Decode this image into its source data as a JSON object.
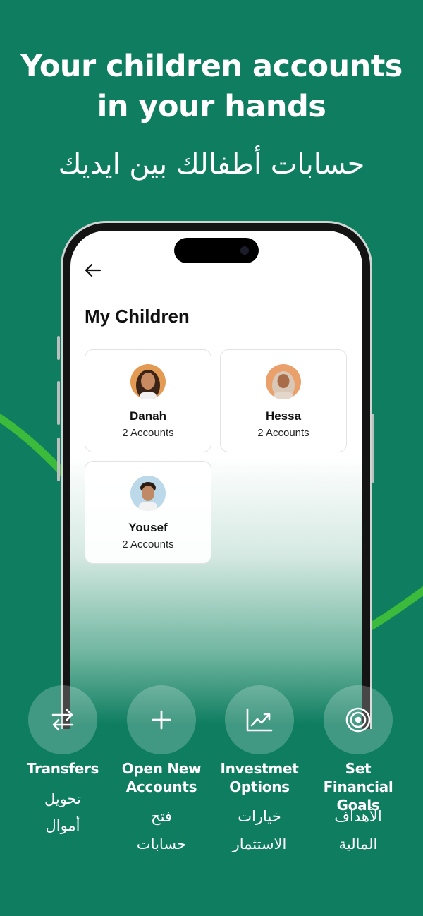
{
  "headline": {
    "line1": "Your children accounts",
    "line2": "in your hands",
    "arabic": "حسابات أطفالك بين ايديك"
  },
  "screen": {
    "back_icon": "arrow-left-icon",
    "title": "My Children",
    "children": [
      {
        "name": "Danah",
        "accounts": "2 Accounts",
        "avatar": "girl-avatar"
      },
      {
        "name": "Hessa",
        "accounts": "2 Accounts",
        "avatar": "girl-hijab-avatar"
      },
      {
        "name": "Yousef",
        "accounts": "2 Accounts",
        "avatar": "boy-avatar"
      }
    ]
  },
  "features": [
    {
      "label_l1": "Transfers",
      "label_l2": "",
      "ar_l1": "تحويل",
      "ar_l2": "أموال",
      "icon": "transfer-arrows-icon"
    },
    {
      "label_l1": "Open New",
      "label_l2": "Accounts",
      "ar_l1": "فتح",
      "ar_l2": "حسابات",
      "icon": "plus-icon"
    },
    {
      "label_l1": "Investmet",
      "label_l2": "Options",
      "ar_l1": "خيارات",
      "ar_l2": "الاستثمار",
      "icon": "chart-trend-icon"
    },
    {
      "label_l1": "Set Financial",
      "label_l2": "Goals",
      "ar_l1": "الأهداف",
      "ar_l2": "المالية",
      "icon": "target-icon"
    }
  ],
  "colors": {
    "background": "#0e7d60",
    "accent_curve": "#3cba3c",
    "text_on_bg": "#ffffff"
  }
}
